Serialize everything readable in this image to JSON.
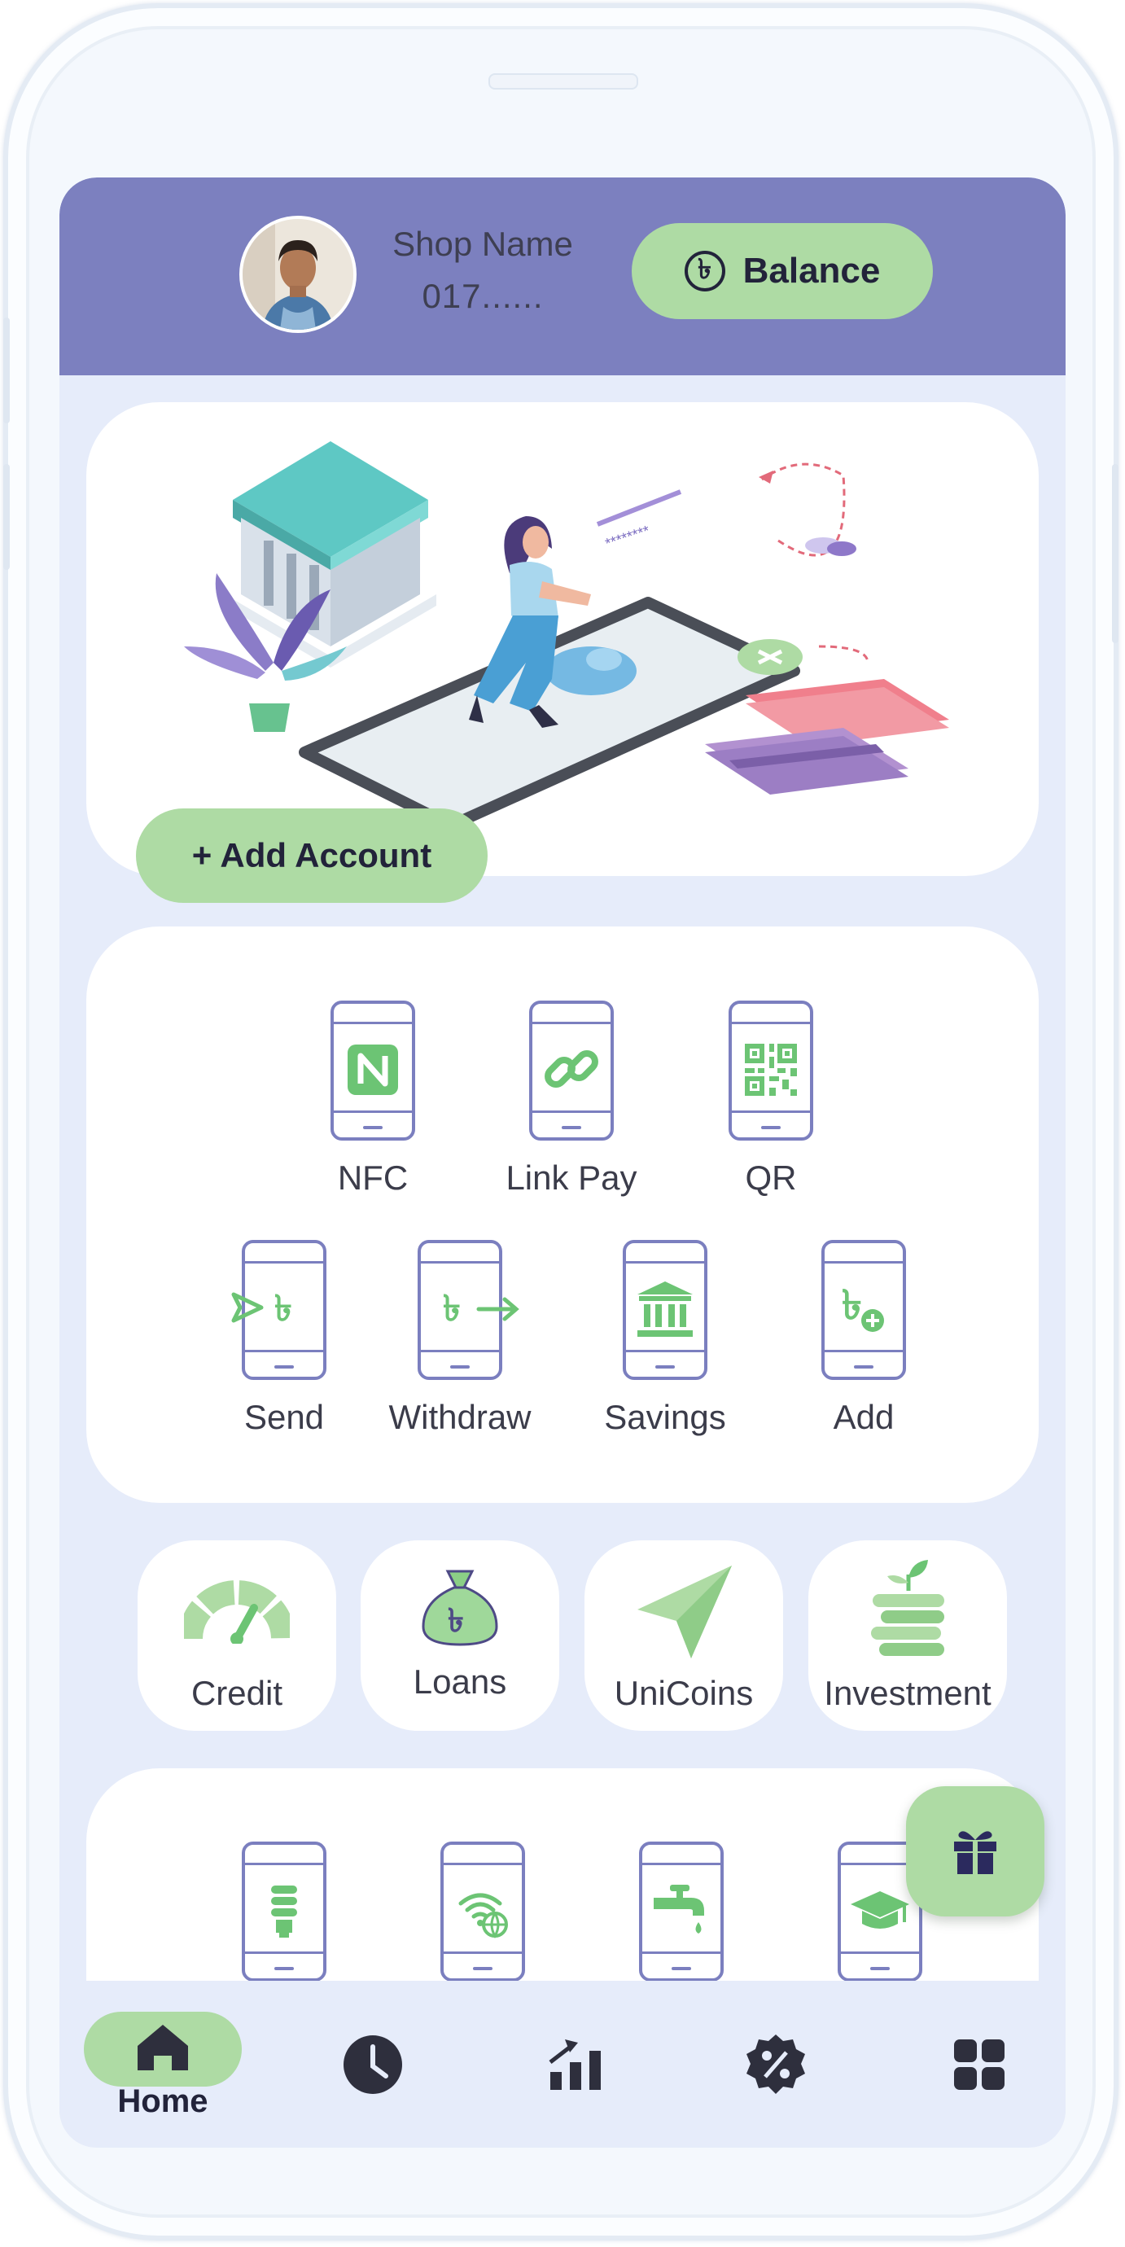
{
  "header": {
    "shop_name": "Shop Name",
    "shop_phone": "017......",
    "balance_label": "Balance",
    "currency_symbol": "৳"
  },
  "banner": {
    "add_account_label": "+ Add Account",
    "masked_text": "********"
  },
  "services": {
    "row1": [
      {
        "label": "NFC",
        "icon": "nfc-icon"
      },
      {
        "label": "Link Pay",
        "icon": "link-icon"
      },
      {
        "label": "QR",
        "icon": "qr-code-icon"
      }
    ],
    "row2": [
      {
        "label": "Send",
        "icon": "send-money-icon"
      },
      {
        "label": "Withdraw",
        "icon": "withdraw-icon"
      },
      {
        "label": "Savings",
        "icon": "bank-icon"
      },
      {
        "label": "Add",
        "icon": "add-money-icon"
      }
    ]
  },
  "features": [
    {
      "label": "Credit",
      "icon": "speedometer-icon"
    },
    {
      "label": "Loans",
      "icon": "money-bag-icon"
    },
    {
      "label": "UniCoins",
      "icon": "paper-plane-icon"
    },
    {
      "label": "Investment",
      "icon": "coin-stack-plant-icon"
    }
  ],
  "bills": [
    {
      "icon": "electricity-bulb-icon"
    },
    {
      "icon": "internet-globe-icon"
    },
    {
      "icon": "water-tap-icon"
    },
    {
      "icon": "education-cap-icon"
    }
  ],
  "nav": {
    "home_label": "Home",
    "items": [
      "home-icon",
      "history-clock-icon",
      "stats-chart-icon",
      "offers-percent-icon",
      "apps-grid-icon"
    ]
  },
  "colors": {
    "header": "#7c80bf",
    "accent_green": "#aedba4",
    "icon_green": "#6cc474",
    "screen_bg": "#e6ecfa",
    "dark": "#22233a"
  }
}
